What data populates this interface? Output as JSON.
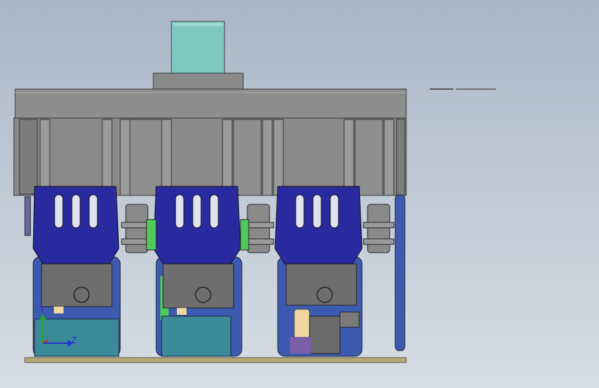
{
  "viewport": {
    "background_top": "#a9b6c6",
    "background_bottom": "#d6dde4"
  },
  "model": {
    "pole_count": 3,
    "colors": {
      "frame": "#8e8e8e",
      "frame_dark": "#5c5c5c",
      "handle": "#7ec8c0",
      "cover_plate": "#2a2aa0",
      "terminal_block": "#3a8a9a",
      "green_part": "#4ecb5c",
      "contact_gold": "#f2d8a0",
      "base_plate": "#b8a873"
    }
  },
  "triad": {
    "y_label": "Y",
    "z_label": "Z",
    "x_color": "#cc2222",
    "y_color": "#22aa22",
    "z_color": "#2233cc"
  }
}
